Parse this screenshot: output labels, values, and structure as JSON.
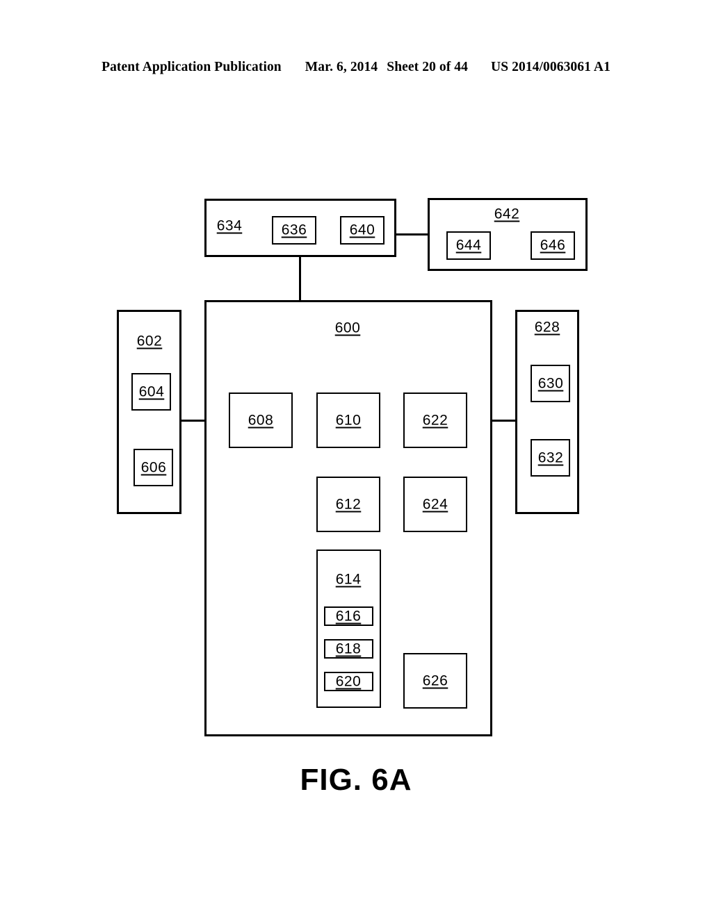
{
  "header": {
    "publication": "Patent Application Publication",
    "date": "Mar. 6, 2014",
    "sheet": "Sheet 20 of 44",
    "patent_number": "US 2014/0063061 A1"
  },
  "figure": {
    "caption": "FIG. 6A",
    "boxes": {
      "b600": "600",
      "b602": "602",
      "b604": "604",
      "b606": "606",
      "b608": "608",
      "b610": "610",
      "b612": "612",
      "b614": "614",
      "b616": "616",
      "b618": "618",
      "b620": "620",
      "b622": "622",
      "b624": "624",
      "b626": "626",
      "b628": "628",
      "b630": "630",
      "b632": "632",
      "b634": "634",
      "b636": "636",
      "b640": "640",
      "b642": "642",
      "b644": "644",
      "b646": "646"
    }
  },
  "colors": {
    "ink": "#000000",
    "paper": "#ffffff"
  }
}
